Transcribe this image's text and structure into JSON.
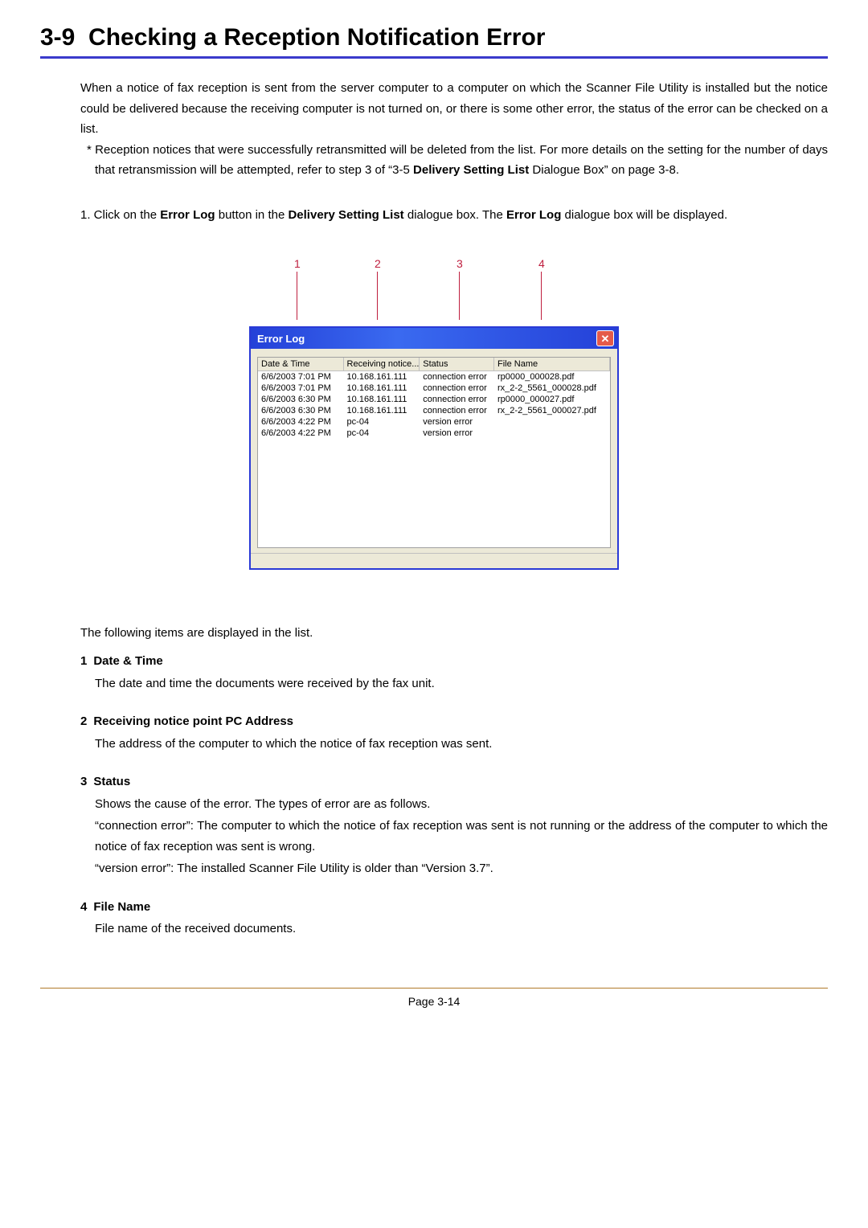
{
  "section_number": "3-9",
  "section_title": "Checking a Reception Notification Error",
  "intro": "When a notice of fax reception is sent from the server computer to a computer on which the Scanner File Utility is installed but the notice could be delivered because the receiving computer is not turned on, or there is some other error, the status of the error can be checked on a list.",
  "note_prefix": "* Reception notices that were successfully retransmitted will be deleted from the list. For more details on the setting for the number of days that retransmission will be attempted, refer to step 3 of “3-5 ",
  "note_bold": "Delivery Setting List",
  "note_suffix": " Dialogue Box” on page 3-8.",
  "step1_a": "1. Click on the ",
  "step1_b1": "Error Log",
  "step1_c": " button in the ",
  "step1_b2": "Delivery Setting List",
  "step1_d": " dialogue box. The ",
  "step1_b3": "Error Log",
  "step1_e": " dialogue box will be displayed.",
  "callouts": [
    "1",
    "2",
    "3",
    "4"
  ],
  "dialog": {
    "title": "Error Log",
    "columns": [
      "Date & Time",
      "Receiving notice...",
      "Status",
      "File Name"
    ],
    "rows": [
      {
        "dt": "6/6/2003 7:01 PM",
        "addr": "10.168.161.111",
        "status": "connection error",
        "file": "rp0000_000028.pdf"
      },
      {
        "dt": "6/6/2003 7:01 PM",
        "addr": "10.168.161.111",
        "status": "connection error",
        "file": "rx_2-2_5561_000028.pdf"
      },
      {
        "dt": "6/6/2003 6:30 PM",
        "addr": "10.168.161.111",
        "status": "connection error",
        "file": "rp0000_000027.pdf"
      },
      {
        "dt": "6/6/2003 6:30 PM",
        "addr": "10.168.161.111",
        "status": "connection error",
        "file": "rx_2-2_5561_000027.pdf"
      },
      {
        "dt": "6/6/2003 4:22 PM",
        "addr": "pc-04",
        "status": "version error",
        "file": ""
      },
      {
        "dt": "6/6/2003 4:22 PM",
        "addr": "pc-04",
        "status": "version error",
        "file": ""
      }
    ]
  },
  "list_intro": "The following items are displayed in the list.",
  "items": [
    {
      "num": "1",
      "title": "Date & Time",
      "desc": "The date and time the documents were received by the fax unit."
    },
    {
      "num": "2",
      "title": "Receiving notice point PC Address",
      "desc": "The address of the computer to which the notice of fax reception was sent."
    },
    {
      "num": "3",
      "title": "Status",
      "desc_lines": [
        "Shows the cause of the error. The types of error are as follows.",
        "“connection error”: The computer to which the notice of fax reception was sent is not running or the address of the computer to which the notice of fax reception was sent is wrong.",
        "“version error”: The installed Scanner File Utility is older than “Version 3.7”."
      ]
    },
    {
      "num": "4",
      "title": "File Name",
      "desc": "File name of the received documents."
    }
  ],
  "page_label": "Page 3-14"
}
